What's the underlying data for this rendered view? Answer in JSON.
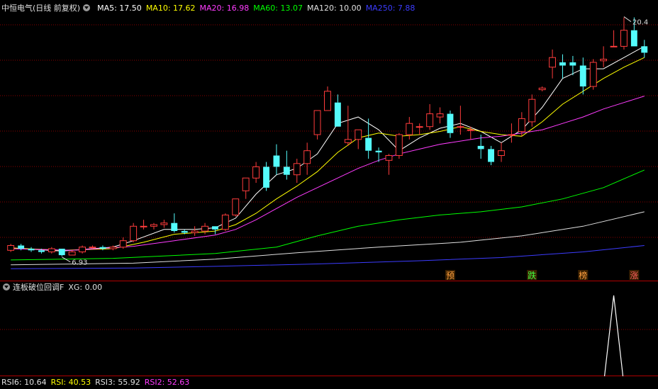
{
  "header": {
    "stock_title": "中恒电气(日线 前复权)",
    "ma_labels": [
      {
        "text": "MA5: 17.50",
        "color": "#ffffff"
      },
      {
        "text": "MA10: 17.62",
        "color": "#ffff00"
      },
      {
        "text": "MA20: 16.98",
        "color": "#ff3cff"
      },
      {
        "text": "MA60: 13.07",
        "color": "#00ff00"
      },
      {
        "text": "MA120: 10.00",
        "color": "#e0e0e0"
      },
      {
        "text": "MA250: 7.88",
        "color": "#3c3cff"
      }
    ]
  },
  "indicator": {
    "title": "连板破位回调F",
    "xg_label": "XG: 0.00"
  },
  "bottom_header": {
    "labels": [
      {
        "text": "RSI6: 10.64",
        "color": "#e0e0e0"
      },
      {
        "text": "RSI: 40.53",
        "color": "#ffff00"
      },
      {
        "text": "RSI3: 55.92",
        "color": "#e0e0e0"
      },
      {
        "text": "RSI2: 52.63",
        "color": "#ff3cff"
      }
    ]
  },
  "colors": {
    "up": "#ff3c3c",
    "down": "#54fcfc",
    "grid": "#8a0000",
    "axis": "#b00000"
  },
  "chart_data": {
    "type": "candlestick",
    "price_range": [
      5.9,
      22.0
    ],
    "annotations": {
      "low_label": "6.93",
      "high_label": "20.4"
    },
    "signal_markers": [
      {
        "text": "预",
        "color": "#ffa040"
      },
      {
        "text": "跌",
        "color": "#40ff40"
      },
      {
        "text": "榜",
        "color": "#ffa040"
      },
      {
        "text": "涨",
        "color": "#ff6060"
      }
    ],
    "candles": [
      [
        7.3,
        7.7,
        7.2,
        7.6
      ],
      [
        7.6,
        7.7,
        7.3,
        7.4
      ],
      [
        7.4,
        7.5,
        7.2,
        7.3
      ],
      [
        7.3,
        7.4,
        7.1,
        7.2
      ],
      [
        7.2,
        7.5,
        7.1,
        7.4
      ],
      [
        7.4,
        7.4,
        6.93,
        7.0
      ],
      [
        7.0,
        7.3,
        7.0,
        7.2
      ],
      [
        7.2,
        7.6,
        7.1,
        7.5
      ],
      [
        7.5,
        7.6,
        7.4,
        7.5
      ],
      [
        7.5,
        7.6,
        7.3,
        7.4
      ],
      [
        7.4,
        7.6,
        7.3,
        7.5
      ],
      [
        7.5,
        8.1,
        7.4,
        7.9
      ],
      [
        7.9,
        9.0,
        7.8,
        8.8
      ],
      [
        8.8,
        9.2,
        8.6,
        8.8
      ],
      [
        8.8,
        9.0,
        8.6,
        8.9
      ],
      [
        8.9,
        9.2,
        8.7,
        9.0
      ],
      [
        9.0,
        9.6,
        8.4,
        8.5
      ],
      [
        8.5,
        8.6,
        8.3,
        8.4
      ],
      [
        8.4,
        8.8,
        8.2,
        8.5
      ],
      [
        8.5,
        9.0,
        8.3,
        8.8
      ],
      [
        8.8,
        8.8,
        8.3,
        8.6
      ],
      [
        8.6,
        9.6,
        8.5,
        9.5
      ],
      [
        9.5,
        10.5,
        9.4,
        10.5
      ],
      [
        11.0,
        11.5,
        10.5,
        11.8
      ],
      [
        11.8,
        12.8,
        11.5,
        12.5
      ],
      [
        12.5,
        12.8,
        11.0,
        11.2
      ],
      [
        13.2,
        13.9,
        12.0,
        12.5
      ],
      [
        12.5,
        13.5,
        11.7,
        12.0
      ],
      [
        12.0,
        13.0,
        11.5,
        12.7
      ],
      [
        12.7,
        14.0,
        12.0,
        13.5
      ],
      [
        14.5,
        15.5,
        14.2,
        16.0
      ],
      [
        16.0,
        17.5,
        16.0,
        17.2
      ],
      [
        16.5,
        17.0,
        15.0,
        15.0
      ],
      [
        14.0,
        16.3,
        13.8,
        14.2
      ],
      [
        14.2,
        14.8,
        13.6,
        14.8
      ],
      [
        14.3,
        15.5,
        13.0,
        13.5
      ],
      [
        13.5,
        13.7,
        12.8,
        13.4
      ],
      [
        12.9,
        13.3,
        12.0,
        13.2
      ],
      [
        13.2,
        14.6,
        13.0,
        14.5
      ],
      [
        14.5,
        15.6,
        14.2,
        15.2
      ],
      [
        15.0,
        15.2,
        14.5,
        15.0
      ],
      [
        15.0,
        16.4,
        14.8,
        15.8
      ],
      [
        15.6,
        16.2,
        15.2,
        15.8
      ],
      [
        15.8,
        16.0,
        14.3,
        14.6
      ],
      [
        15.0,
        16.3,
        14.5,
        15.0
      ],
      [
        14.8,
        15.0,
        14.2,
        14.8
      ],
      [
        13.8,
        14.5,
        13.0,
        13.6
      ],
      [
        13.6,
        13.8,
        12.6,
        12.8
      ],
      [
        13.2,
        14.0,
        12.8,
        13.5
      ],
      [
        14.5,
        15.2,
        14.0,
        14.5
      ],
      [
        14.7,
        15.9,
        14.4,
        15.5
      ],
      [
        15.3,
        17.0,
        15.0,
        16.7
      ],
      [
        17.3,
        17.5,
        17.2,
        17.4
      ],
      [
        18.7,
        19.8,
        18.0,
        19.3
      ],
      [
        19.0,
        19.5,
        18.0,
        18.8
      ],
      [
        19.0,
        19.4,
        18.2,
        18.8
      ],
      [
        18.8,
        19.3,
        17.0,
        17.5
      ],
      [
        17.5,
        19.2,
        17.3,
        19.0
      ],
      [
        19.1,
        20.0,
        18.7,
        19.2
      ],
      [
        20.0,
        21.0,
        20.0,
        20.0
      ],
      [
        20.0,
        21.8,
        19.8,
        21.0
      ],
      [
        21.0,
        21.8,
        20.0,
        20.0
      ],
      [
        20.0,
        20.4,
        19.3,
        19.6
      ]
    ],
    "ma": {
      "MA5": [
        [
          0,
          7.45
        ],
        [
          5,
          7.25
        ],
        [
          10,
          7.5
        ],
        [
          12,
          7.9
        ],
        [
          15,
          8.6
        ],
        [
          18,
          8.6
        ],
        [
          20,
          8.7
        ],
        [
          22,
          9.3
        ],
        [
          24,
          10.8
        ],
        [
          26,
          12.0
        ],
        [
          28,
          12.4
        ],
        [
          30,
          13.3
        ],
        [
          32,
          15.2
        ],
        [
          34,
          15.6
        ],
        [
          36,
          14.8
        ],
        [
          38,
          13.5
        ],
        [
          40,
          14.3
        ],
        [
          42,
          14.9
        ],
        [
          44,
          15.2
        ],
        [
          46,
          14.7
        ],
        [
          48,
          14.0
        ],
        [
          50,
          14.8
        ],
        [
          52,
          16.2
        ],
        [
          54,
          18.0
        ],
        [
          56,
          18.6
        ],
        [
          58,
          18.6
        ],
        [
          60,
          19.3
        ],
        [
          62,
          20.0
        ]
      ],
      "MA10": [
        [
          0,
          7.45
        ],
        [
          5,
          7.3
        ],
        [
          10,
          7.4
        ],
        [
          13,
          7.8
        ],
        [
          16,
          8.3
        ],
        [
          20,
          8.5
        ],
        [
          22,
          8.9
        ],
        [
          24,
          9.6
        ],
        [
          26,
          10.5
        ],
        [
          28,
          11.3
        ],
        [
          30,
          12.2
        ],
        [
          32,
          13.4
        ],
        [
          34,
          14.3
        ],
        [
          36,
          14.6
        ],
        [
          38,
          14.4
        ],
        [
          40,
          14.5
        ],
        [
          42,
          14.7
        ],
        [
          44,
          15.0
        ],
        [
          46,
          14.7
        ],
        [
          48,
          14.5
        ],
        [
          50,
          14.4
        ],
        [
          52,
          15.3
        ],
        [
          54,
          16.4
        ],
        [
          56,
          17.2
        ],
        [
          58,
          18.0
        ],
        [
          60,
          18.7
        ],
        [
          62,
          19.3
        ]
      ],
      "MA20": [
        [
          0,
          7.4
        ],
        [
          6,
          7.3
        ],
        [
          12,
          7.55
        ],
        [
          16,
          7.9
        ],
        [
          20,
          8.25
        ],
        [
          22,
          8.6
        ],
        [
          24,
          9.2
        ],
        [
          26,
          9.9
        ],
        [
          28,
          10.6
        ],
        [
          30,
          11.2
        ],
        [
          32,
          11.8
        ],
        [
          34,
          12.4
        ],
        [
          36,
          12.9
        ],
        [
          38,
          13.3
        ],
        [
          40,
          13.6
        ],
        [
          42,
          13.9
        ],
        [
          44,
          14.1
        ],
        [
          46,
          14.3
        ],
        [
          48,
          14.4
        ],
        [
          50,
          14.6
        ],
        [
          52,
          14.8
        ],
        [
          54,
          15.2
        ],
        [
          56,
          15.6
        ],
        [
          58,
          16.1
        ],
        [
          60,
          16.5
        ],
        [
          62,
          16.9
        ]
      ],
      "MA60": [
        [
          0,
          6.7
        ],
        [
          10,
          6.8
        ],
        [
          20,
          7.1
        ],
        [
          26,
          7.5
        ],
        [
          30,
          8.2
        ],
        [
          34,
          8.8
        ],
        [
          38,
          9.2
        ],
        [
          42,
          9.5
        ],
        [
          46,
          9.7
        ],
        [
          50,
          10.0
        ],
        [
          54,
          10.5
        ],
        [
          58,
          11.2
        ],
        [
          62,
          12.3
        ]
      ],
      "MA120": [
        [
          0,
          6.4
        ],
        [
          12,
          6.5
        ],
        [
          20,
          6.75
        ],
        [
          28,
          7.15
        ],
        [
          36,
          7.5
        ],
        [
          44,
          7.8
        ],
        [
          50,
          8.2
        ],
        [
          56,
          8.8
        ],
        [
          62,
          9.7
        ]
      ],
      "MA250": [
        [
          0,
          6.15
        ],
        [
          12,
          6.2
        ],
        [
          20,
          6.3
        ],
        [
          30,
          6.45
        ],
        [
          40,
          6.65
        ],
        [
          48,
          6.85
        ],
        [
          56,
          7.2
        ],
        [
          62,
          7.6
        ]
      ]
    }
  }
}
